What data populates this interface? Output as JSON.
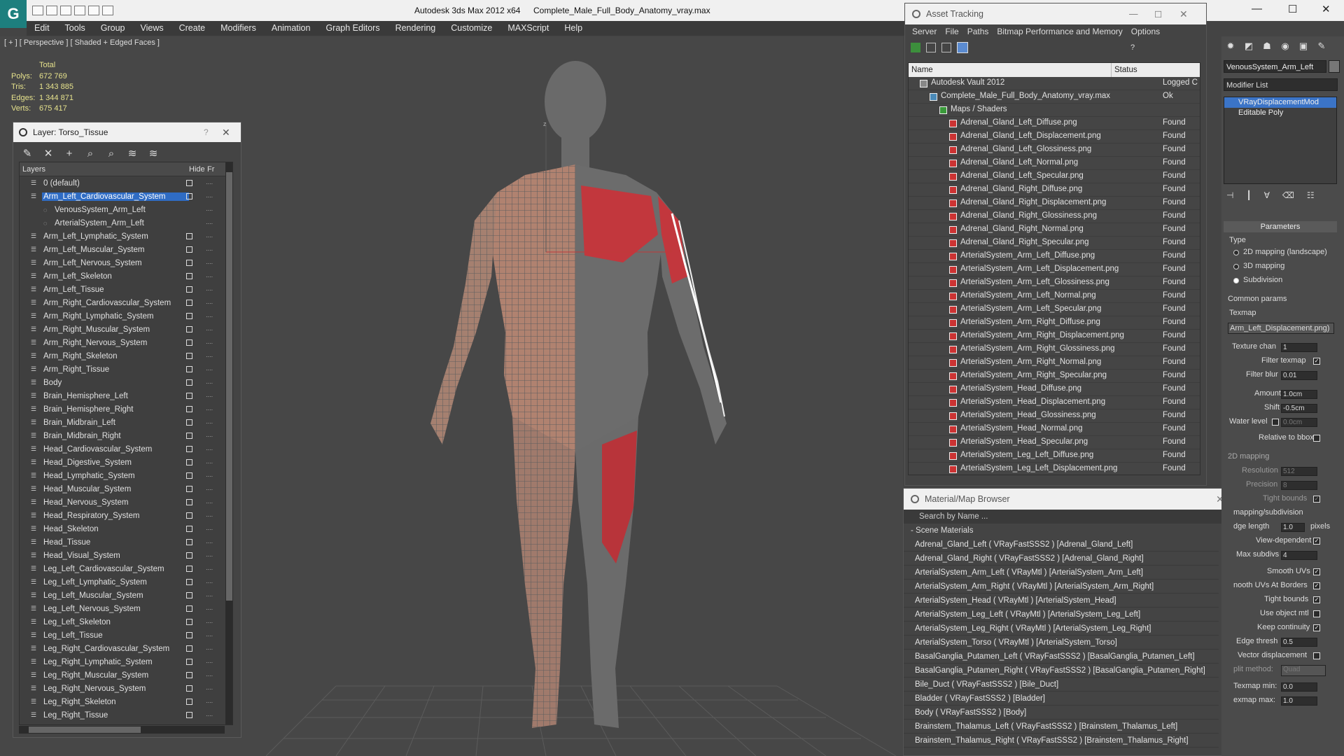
{
  "window": {
    "title_app": "Autodesk 3ds Max  2012 x64",
    "title_file": "Complete_Male_Full_Body_Anatomy_vray.max"
  },
  "menu": [
    "Edit",
    "Tools",
    "Group",
    "Views",
    "Create",
    "Modifiers",
    "Animation",
    "Graph Editors",
    "Rendering",
    "Customize",
    "MAXScript",
    "Help"
  ],
  "viewport": {
    "label": "[ + ] [ Perspective ] [ Shaded + Edged Faces ]",
    "stats": {
      "header": "Total",
      "rows": [
        {
          "k": "Polys:",
          "v": "672 769"
        },
        {
          "k": "Tris:",
          "v": "1 343 885"
        },
        {
          "k": "Edges:",
          "v": "1 344 871"
        },
        {
          "k": "Verts:",
          "v": "675 417"
        }
      ]
    },
    "gizmo_axis_z": "z",
    "gizmo_axis_x": "x"
  },
  "layer_window": {
    "title": "Layer: Torso_Tissue",
    "help": "?",
    "columns": {
      "name": "Layers",
      "hide": "Hide",
      "freeze": "Fr"
    },
    "layers": [
      {
        "name": "0 (default)",
        "type": "layer"
      },
      {
        "name": "Arm_Left_Cardiovascular_System",
        "type": "layer",
        "selected": true
      },
      {
        "name": "VenousSystem_Arm_Left",
        "type": "child"
      },
      {
        "name": "ArterialSystem_Arm_Left",
        "type": "child"
      },
      {
        "name": "Arm_Left_Lymphatic_System",
        "type": "layer"
      },
      {
        "name": "Arm_Left_Muscular_System",
        "type": "layer"
      },
      {
        "name": "Arm_Left_Nervous_System",
        "type": "layer"
      },
      {
        "name": "Arm_Left_Skeleton",
        "type": "layer"
      },
      {
        "name": "Arm_Left_Tissue",
        "type": "layer"
      },
      {
        "name": "Arm_Right_Cardiovascular_System",
        "type": "layer"
      },
      {
        "name": "Arm_Right_Lymphatic_System",
        "type": "layer"
      },
      {
        "name": "Arm_Right_Muscular_System",
        "type": "layer"
      },
      {
        "name": "Arm_Right_Nervous_System",
        "type": "layer"
      },
      {
        "name": "Arm_Right_Skeleton",
        "type": "layer"
      },
      {
        "name": "Arm_Right_Tissue",
        "type": "layer"
      },
      {
        "name": "Body",
        "type": "layer"
      },
      {
        "name": "Brain_Hemisphere_Left",
        "type": "layer"
      },
      {
        "name": "Brain_Hemisphere_Right",
        "type": "layer"
      },
      {
        "name": "Brain_Midbrain_Left",
        "type": "layer"
      },
      {
        "name": "Brain_Midbrain_Right",
        "type": "layer"
      },
      {
        "name": "Head_Cardiovascular_System",
        "type": "layer"
      },
      {
        "name": "Head_Digestive_System",
        "type": "layer"
      },
      {
        "name": "Head_Lymphatic_System",
        "type": "layer"
      },
      {
        "name": "Head_Muscular_System",
        "type": "layer"
      },
      {
        "name": "Head_Nervous_System",
        "type": "layer"
      },
      {
        "name": "Head_Respiratory_System",
        "type": "layer"
      },
      {
        "name": "Head_Skeleton",
        "type": "layer"
      },
      {
        "name": "Head_Tissue",
        "type": "layer"
      },
      {
        "name": "Head_Visual_System",
        "type": "layer"
      },
      {
        "name": "Leg_Left_Cardiovascular_System",
        "type": "layer"
      },
      {
        "name": "Leg_Left_Lymphatic_System",
        "type": "layer"
      },
      {
        "name": "Leg_Left_Muscular_System",
        "type": "layer"
      },
      {
        "name": "Leg_Left_Nervous_System",
        "type": "layer"
      },
      {
        "name": "Leg_Left_Skeleton",
        "type": "layer"
      },
      {
        "name": "Leg_Left_Tissue",
        "type": "layer"
      },
      {
        "name": "Leg_Right_Cardiovascular_System",
        "type": "layer"
      },
      {
        "name": "Leg_Right_Lymphatic_System",
        "type": "layer"
      },
      {
        "name": "Leg_Right_Muscular_System",
        "type": "layer"
      },
      {
        "name": "Leg_Right_Nervous_System",
        "type": "layer"
      },
      {
        "name": "Leg_Right_Skeleton",
        "type": "layer"
      },
      {
        "name": "Leg_Right_Tissue",
        "type": "layer"
      }
    ]
  },
  "asset_tracking": {
    "title": "Asset Tracking",
    "menu": [
      "Server",
      "File",
      "Paths",
      "Bitmap Performance and Memory",
      "Options"
    ],
    "columns": {
      "name": "Name",
      "status": "Status"
    },
    "rows": [
      {
        "name": "Autodesk Vault 2012",
        "status": "Logged C",
        "level": 0
      },
      {
        "name": "Complete_Male_Full_Body_Anatomy_vray.max",
        "status": "Ok",
        "level": 1
      },
      {
        "name": "Maps / Shaders",
        "status": "",
        "level": 2
      },
      {
        "name": "Adrenal_Gland_Left_Diffuse.png",
        "status": "Found",
        "level": 3
      },
      {
        "name": "Adrenal_Gland_Left_Displacement.png",
        "status": "Found",
        "level": 3
      },
      {
        "name": "Adrenal_Gland_Left_Glossiness.png",
        "status": "Found",
        "level": 3
      },
      {
        "name": "Adrenal_Gland_Left_Normal.png",
        "status": "Found",
        "level": 3
      },
      {
        "name": "Adrenal_Gland_Left_Specular.png",
        "status": "Found",
        "level": 3
      },
      {
        "name": "Adrenal_Gland_Right_Diffuse.png",
        "status": "Found",
        "level": 3
      },
      {
        "name": "Adrenal_Gland_Right_Displacement.png",
        "status": "Found",
        "level": 3
      },
      {
        "name": "Adrenal_Gland_Right_Glossiness.png",
        "status": "Found",
        "level": 3
      },
      {
        "name": "Adrenal_Gland_Right_Normal.png",
        "status": "Found",
        "level": 3
      },
      {
        "name": "Adrenal_Gland_Right_Specular.png",
        "status": "Found",
        "level": 3
      },
      {
        "name": "ArterialSystem_Arm_Left_Diffuse.png",
        "status": "Found",
        "level": 3
      },
      {
        "name": "ArterialSystem_Arm_Left_Displacement.png",
        "status": "Found",
        "level": 3
      },
      {
        "name": "ArterialSystem_Arm_Left_Glossiness.png",
        "status": "Found",
        "level": 3
      },
      {
        "name": "ArterialSystem_Arm_Left_Normal.png",
        "status": "Found",
        "level": 3
      },
      {
        "name": "ArterialSystem_Arm_Left_Specular.png",
        "status": "Found",
        "level": 3
      },
      {
        "name": "ArterialSystem_Arm_Right_Diffuse.png",
        "status": "Found",
        "level": 3
      },
      {
        "name": "ArterialSystem_Arm_Right_Displacement.png",
        "status": "Found",
        "level": 3
      },
      {
        "name": "ArterialSystem_Arm_Right_Glossiness.png",
        "status": "Found",
        "level": 3
      },
      {
        "name": "ArterialSystem_Arm_Right_Normal.png",
        "status": "Found",
        "level": 3
      },
      {
        "name": "ArterialSystem_Arm_Right_Specular.png",
        "status": "Found",
        "level": 3
      },
      {
        "name": "ArterialSystem_Head_Diffuse.png",
        "status": "Found",
        "level": 3
      },
      {
        "name": "ArterialSystem_Head_Displacement.png",
        "status": "Found",
        "level": 3
      },
      {
        "name": "ArterialSystem_Head_Glossiness.png",
        "status": "Found",
        "level": 3
      },
      {
        "name": "ArterialSystem_Head_Normal.png",
        "status": "Found",
        "level": 3
      },
      {
        "name": "ArterialSystem_Head_Specular.png",
        "status": "Found",
        "level": 3
      },
      {
        "name": "ArterialSystem_Leg_Left_Diffuse.png",
        "status": "Found",
        "level": 3
      },
      {
        "name": "ArterialSystem_Leg_Left_Displacement.png",
        "status": "Found",
        "level": 3
      }
    ]
  },
  "material_browser": {
    "title": "Material/Map Browser",
    "search_placeholder": "Search by Name ...",
    "section": "- Scene Materials",
    "items": [
      "Adrenal_Gland_Left  ( VRayFastSSS2 ) [Adrenal_Gland_Left]",
      "Adrenal_Gland_Right  ( VRayFastSSS2 ) [Adrenal_Gland_Right]",
      "ArterialSystem_Arm_Left  ( VRayMtl ) [ArterialSystem_Arm_Left]",
      "ArterialSystem_Arm_Right  ( VRayMtl ) [ArterialSystem_Arm_Right]",
      "ArterialSystem_Head  ( VRayMtl ) [ArterialSystem_Head]",
      "ArterialSystem_Leg_Left  ( VRayMtl ) [ArterialSystem_Leg_Left]",
      "ArterialSystem_Leg_Right  ( VRayMtl ) [ArterialSystem_Leg_Right]",
      "ArterialSystem_Torso  ( VRayMtl ) [ArterialSystem_Torso]",
      "BasalGanglia_Putamen_Left  ( VRayFastSSS2 ) [BasalGanglia_Putamen_Left]",
      "BasalGanglia_Putamen_Right  ( VRayFastSSS2 ) [BasalGanglia_Putamen_Right]",
      "Bile_Duct  ( VRayFastSSS2 ) [Bile_Duct]",
      "Bladder  ( VRayFastSSS2 ) [Bladder]",
      "Body  ( VRayFastSSS2 ) [Body]",
      "Brainstem_Thalamus_Left  ( VRayFastSSS2 ) [Brainstem_Thalamus_Left]",
      "Brainstem_Thalamus_Right  ( VRayFastSSS2 ) [Brainstem_Thalamus_Right]"
    ]
  },
  "command_panel": {
    "object_name": "VenousSystem_Arm_Left",
    "modifier_list": "Modifier List",
    "stack": [
      "VRayDisplacementMod",
      "Editable Poly"
    ],
    "parameters_title": "Parameters",
    "type_label": "Type",
    "type_options": [
      {
        "label": "2D mapping (landscape)",
        "on": false
      },
      {
        "label": "3D mapping",
        "on": false
      },
      {
        "label": "Subdivision",
        "on": true
      }
    ],
    "common_params": "Common params",
    "texmap_label": "Texmap",
    "texmap_value": "Arm_Left_Displacement.png)",
    "texture_chan": {
      "label": "Texture chan",
      "value": "1"
    },
    "filter_texmap": {
      "label": "Filter texmap",
      "checked": true
    },
    "filter_blur": {
      "label": "Filter blur",
      "value": "0.01"
    },
    "amount": {
      "label": "Amount",
      "value": "1.0cm"
    },
    "shift": {
      "label": "Shift",
      "value": "-0.5cm"
    },
    "water_level": {
      "label": "Water level",
      "value": "0.0cm"
    },
    "relative_bbox": {
      "label": "Relative to bbox"
    },
    "mapping2d": "2D mapping",
    "resolution": {
      "label": "Resolution",
      "value": "512"
    },
    "precision": {
      "label": "Precision",
      "value": "8"
    },
    "tight_bounds_2d": {
      "label": "Tight bounds"
    },
    "subdiv_section": "mapping/subdivision",
    "edge_length": {
      "label": "dge length",
      "value": "1.0",
      "unit": "pixels"
    },
    "view_dependent": {
      "label": "View-dependent"
    },
    "max_subdivs": {
      "label": "Max subdivs",
      "value": "4"
    },
    "checks": [
      {
        "label": "Smooth UVs",
        "checked": true
      },
      {
        "label": "nooth UVs At Borders",
        "checked": true
      },
      {
        "label": "Tight bounds",
        "checked": true
      },
      {
        "label": "Use object mtl",
        "checked": false
      },
      {
        "label": "Keep continuity",
        "checked": true
      }
    ],
    "edge_thresh": {
      "label": "Edge thresh",
      "value": "0.5"
    },
    "vector_disp": {
      "label": "Vector displacement"
    },
    "split_method": {
      "label": "plit method:",
      "value": "Quad"
    },
    "texmap_min": {
      "label": "Texmap min:",
      "value": "0.0"
    },
    "texmap_max": {
      "label": "exmap max:",
      "value": "1.0"
    }
  }
}
